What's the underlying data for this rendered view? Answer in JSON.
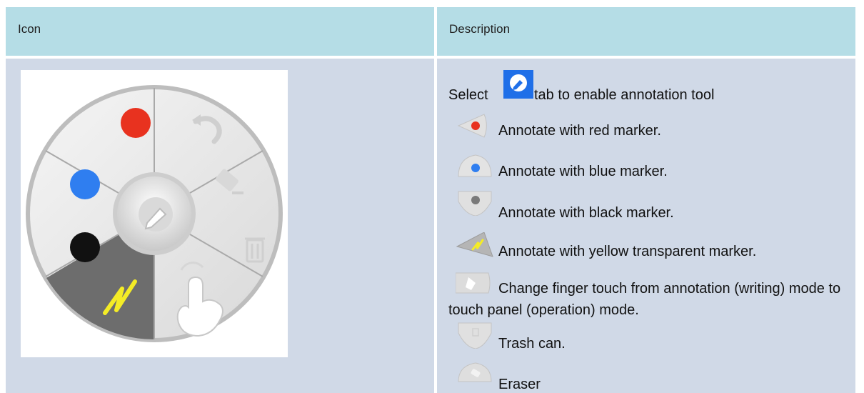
{
  "table": {
    "headers": {
      "icon": "Icon",
      "description": "Description"
    }
  },
  "descriptions": {
    "select_prefix": "Select",
    "select_suffix": "tab to enable annotation tool",
    "red": "Annotate with red marker.",
    "blue": "Annotate with blue marker.",
    "black": "Annotate with black marker.",
    "yellow": "Annotate with yellow transparent marker.",
    "touch": "Change finger touch from annotation (writing) mode to touch panel (operation) mode.",
    "trash": "Trash can.",
    "eraser": "Eraser"
  },
  "colors": {
    "header_bg": "#b5dde6",
    "body_bg": "#d0d9e7",
    "red_dot": "#e8321f",
    "blue_dot": "#2f7ef0",
    "black_dot": "#111111",
    "yellow_mark": "#f4ec26",
    "tab_icon_bg": "#1f6fe8"
  },
  "icons": [
    "pen-icon",
    "undo-icon",
    "eraser-icon",
    "trash-icon",
    "touch-hand-icon",
    "yellow-marker-icon",
    "red-marker-icon",
    "blue-marker-icon",
    "black-marker-icon",
    "annotation-tab-icon"
  ]
}
